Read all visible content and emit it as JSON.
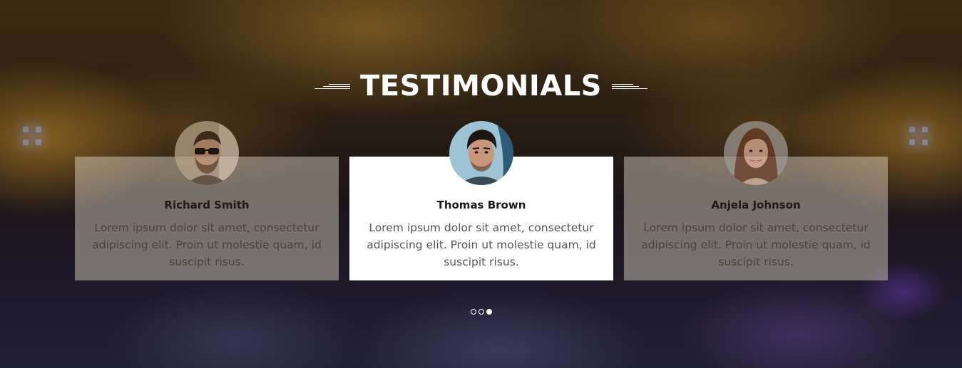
{
  "section": {
    "title": "TESTIMONIALS"
  },
  "testimonials": [
    {
      "name": "Richard Smith",
      "quote": "Lorem ipsum dolor sit amet, consectetur adipiscing elit. Proin ut molestie quam, id suscipit risus.",
      "avatar_icon": "man-sunglasses-avatar",
      "state": "faded"
    },
    {
      "name": "Thomas Brown",
      "quote": "Lorem ipsum dolor sit amet, consectetur adipiscing elit. Proin ut molestie quam, id suscipit risus.",
      "avatar_icon": "man-dark-hair-avatar",
      "state": "active"
    },
    {
      "name": "Anjela Johnson",
      "quote": "Lorem ipsum dolor sit amet, consectetur adipiscing elit. Proin ut molestie quam, id suscipit risus.",
      "avatar_icon": "woman-smiling-avatar",
      "state": "faded"
    }
  ],
  "pagination": {
    "count": 3,
    "active_index": 2
  },
  "colors": {
    "active_card": "#ffffff",
    "faded_card": "#e8decd",
    "title": "#ffffff"
  }
}
